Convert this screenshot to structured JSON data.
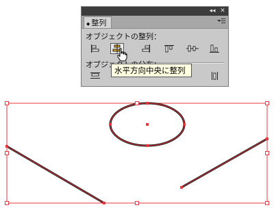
{
  "panel": {
    "tab_label": "整列",
    "collapse_glyph": "◂◂",
    "close_glyph": "✕",
    "menu_glyph": "▾≡",
    "align_section_label": "オブジェクトの整列：",
    "distribute_section_label": "オブジェクトの分布：",
    "align_buttons": [
      {
        "icon": "align-left-edge-icon"
      },
      {
        "icon": "align-horizontal-center-icon",
        "active": true
      },
      {
        "icon": "align-right-edge-icon"
      },
      {
        "icon": "align-top-edge-icon"
      },
      {
        "icon": "align-vertical-center-icon"
      },
      {
        "icon": "align-bottom-edge-icon"
      }
    ],
    "distribute_buttons": [
      {
        "icon": "distribute-top-icon"
      },
      {
        "icon": "distribute-right-icon"
      }
    ]
  },
  "tooltip": {
    "text": "水平方向中央に整列"
  },
  "colors": {
    "selection": "#e8353b",
    "panel_bg": "#c9c9c9",
    "titlebar": "#3c3c3c",
    "tooltip_bg": "#ffffe1"
  }
}
